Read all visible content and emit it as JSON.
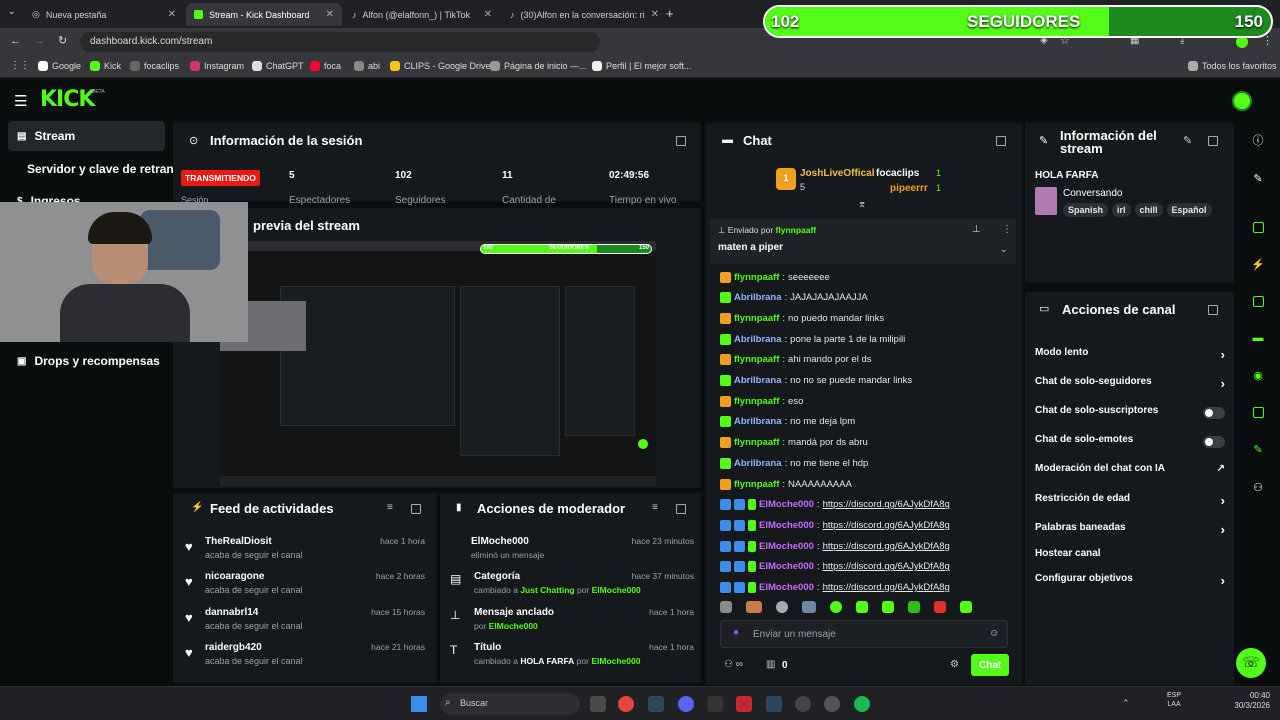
{
  "browser": {
    "tabs": [
      {
        "label": "Nueva pestaña",
        "active": false
      },
      {
        "label": "Stream - Kick Dashboard",
        "active": true
      },
      {
        "label": "Alfon (@elalfonn_) | TikTok",
        "active": false
      },
      {
        "label": "(30)Alfon en la conversación: ri",
        "active": false
      }
    ],
    "url": "dashboard.kick.com/stream",
    "bookmarks": [
      "Google",
      "Kick",
      "focaclips",
      "Instagram",
      "ChatGPT",
      "foca",
      "abi",
      "CLIPS - Google Drive",
      "Página de inicio —...",
      "Perfil | El mejor soft...",
      "Todos los favoritos"
    ]
  },
  "overlay": {
    "current": "102",
    "label": "SEGUIDORES",
    "goal": "150",
    "progress": 0.68
  },
  "kick": {
    "logo": "KICK",
    "logo_sup": "BETA",
    "nav": [
      {
        "label": "Stream",
        "active": true
      },
      {
        "label": "Servidor y clave de retransm"
      },
      {
        "label": "Ingresos"
      },
      {
        "label": "Drops y recompensas"
      }
    ],
    "session": {
      "title": "Información de la sesión",
      "status": "TRANSMITIENDO",
      "status_sub": "Sesión",
      "stats": [
        {
          "value": "5",
          "label": "Espectadores"
        },
        {
          "value": "102",
          "label": "Seguidores"
        },
        {
          "value": "11",
          "label": "Cantidad de"
        },
        {
          "value": "02:49:56",
          "label": "Tiempo en vivo"
        }
      ]
    },
    "preview": {
      "title": "previa del stream",
      "mini_label": "SEGUIDORES",
      "mini_current": "102",
      "mini_goal": "150"
    },
    "feed": {
      "title": "Feed de actividades",
      "items": [
        {
          "name": "TheRealDiosit",
          "sub": "acaba de seguir el canal",
          "time": "hace 1 hora"
        },
        {
          "name": "nicoaragone",
          "sub": "acaba de seguir el canal",
          "time": "hace 2 horas"
        },
        {
          "name": "dannabrl14",
          "sub": "acaba de seguir el canal",
          "time": "hace 15 horas"
        },
        {
          "name": "raidergb420",
          "sub": "acaba de seguir el canal",
          "time": "hace 21 horas"
        }
      ]
    },
    "mod": {
      "title": "Acciones de moderador",
      "items": [
        {
          "name": "ElMoche000",
          "pre": "eliminó un mensaje",
          "mid": "",
          "post": "",
          "by": "",
          "time": "hace 23 minutos",
          "icon": "user-icon"
        },
        {
          "name": "Categoría",
          "pre": "cambiado a ",
          "mid": "Just Chatting",
          "post": " por ",
          "by": "ElMoche000",
          "time": "hace 37 minutos",
          "icon": "category-icon"
        },
        {
          "name": "Mensaje anclado",
          "pre": "por ",
          "mid": "",
          "post": "",
          "by": "ElMoche000",
          "time": "hace 1 hora",
          "icon": "pin-icon"
        },
        {
          "name": "Título",
          "pre": "cambiado a ",
          "mid_white": "HOLA FARFA",
          "post": " por ",
          "by": "ElMoche000",
          "time": "hace 1 hora",
          "icon": "title-icon"
        }
      ]
    },
    "chat": {
      "title": "Chat",
      "top": [
        {
          "rank": "1",
          "name": "JoshLiveOffical",
          "count": "5"
        },
        {
          "rank": "",
          "name": "focaclips",
          "count": "1"
        },
        {
          "rank": "",
          "name": "pipeerrr",
          "count": "1"
        }
      ],
      "pinned_by_label": "Enviado por",
      "pinned_by": "flynnpaaff",
      "pinned_msg": "maten a piper",
      "messages": [
        {
          "user": "flynnpaaff",
          "text": "seeeeeee",
          "color": "#53fc18",
          "badge": "crown"
        },
        {
          "user": "Abrilbrana",
          "text": "JAJAJAJAJAAJJA",
          "color": "#53fc18",
          "badge": "green"
        },
        {
          "user": "flynnpaaff",
          "text": "no puedo mandar links",
          "color": "#53fc18",
          "badge": "crown"
        },
        {
          "user": "Abrilbrana",
          "text": "pone la parte 1 de la milipili",
          "color": "#53fc18",
          "badge": "green"
        },
        {
          "user": "flynnpaaff",
          "text": "ahi mando por el ds",
          "color": "#53fc18",
          "badge": "crown"
        },
        {
          "user": "Abrilbrana",
          "text": "no no se puede mandar links",
          "color": "#53fc18",
          "badge": "green"
        },
        {
          "user": "flynnpaaff",
          "text": "eso",
          "color": "#53fc18",
          "badge": "crown"
        },
        {
          "user": "Abrilbrana",
          "text": "no me deja lpm",
          "color": "#53fc18",
          "badge": "green"
        },
        {
          "user": "flynnpaaff",
          "text": "mandá por ds abru",
          "color": "#53fc18",
          "badge": "crown"
        },
        {
          "user": "Abrilbrana",
          "text": "no me tiene el hdp",
          "color": "#53fc18",
          "badge": "green"
        },
        {
          "user": "flynnpaaff",
          "text": "NAAAAAAAAA",
          "color": "#53fc18",
          "badge": "crown"
        },
        {
          "user": "ElMoche000",
          "text": "https://discord.gg/6AJykDfA8g",
          "color": "#c56bff",
          "badge": "mod",
          "link": true
        },
        {
          "user": "ElMoche000",
          "text": "https://discord.gg/6AJykDfA8g",
          "color": "#c56bff",
          "badge": "mod",
          "link": true
        },
        {
          "user": "ElMoche000",
          "text": "https://discord.gg/6AJykDfA8g",
          "color": "#c56bff",
          "badge": "mod",
          "link": true
        },
        {
          "user": "ElMoche000",
          "text": "https://discord.gg/6AJykDfA8g",
          "color": "#c56bff",
          "badge": "mod",
          "link": true
        },
        {
          "user": "ElMoche000",
          "text": "https://discord.gg/6AJykDfA8g",
          "color": "#c56bff",
          "badge": "mod",
          "link": true
        }
      ],
      "input_placeholder": "Enviar un mensaje",
      "points": "0",
      "send_label": "Chat"
    },
    "stream_info": {
      "title": "Información del stream",
      "stream_title": "HOLA FARFA",
      "category": "Conversando",
      "tags": [
        "Spanish",
        "irl",
        "chill",
        "Español"
      ]
    },
    "channel_actions": {
      "title": "Acciones de canal",
      "items": [
        {
          "label": "Modo lento",
          "control": "chevron"
        },
        {
          "label": "Chat de solo-seguidores",
          "control": "chevron"
        },
        {
          "label": "Chat de solo-suscriptores",
          "control": "toggle"
        },
        {
          "label": "Chat de solo-emotes",
          "control": "toggle"
        },
        {
          "label": "Moderación del chat con IA",
          "control": "external"
        },
        {
          "label": "Restricción de edad",
          "control": "chevron"
        },
        {
          "label": "Palabras baneadas",
          "control": "chevron"
        },
        {
          "label": "Hostear canal",
          "control": "none"
        },
        {
          "label": "Configurar objetivos",
          "control": "chevron"
        }
      ]
    }
  },
  "taskbar": {
    "search": "Buscar",
    "lang": "ESP",
    "lang2": "LAA",
    "time": "00:40",
    "date": "30/3/2026"
  },
  "colors": {
    "kick_green": "#53fc18",
    "mod_purple": "#c56bff",
    "live_red": "#e91916"
  }
}
